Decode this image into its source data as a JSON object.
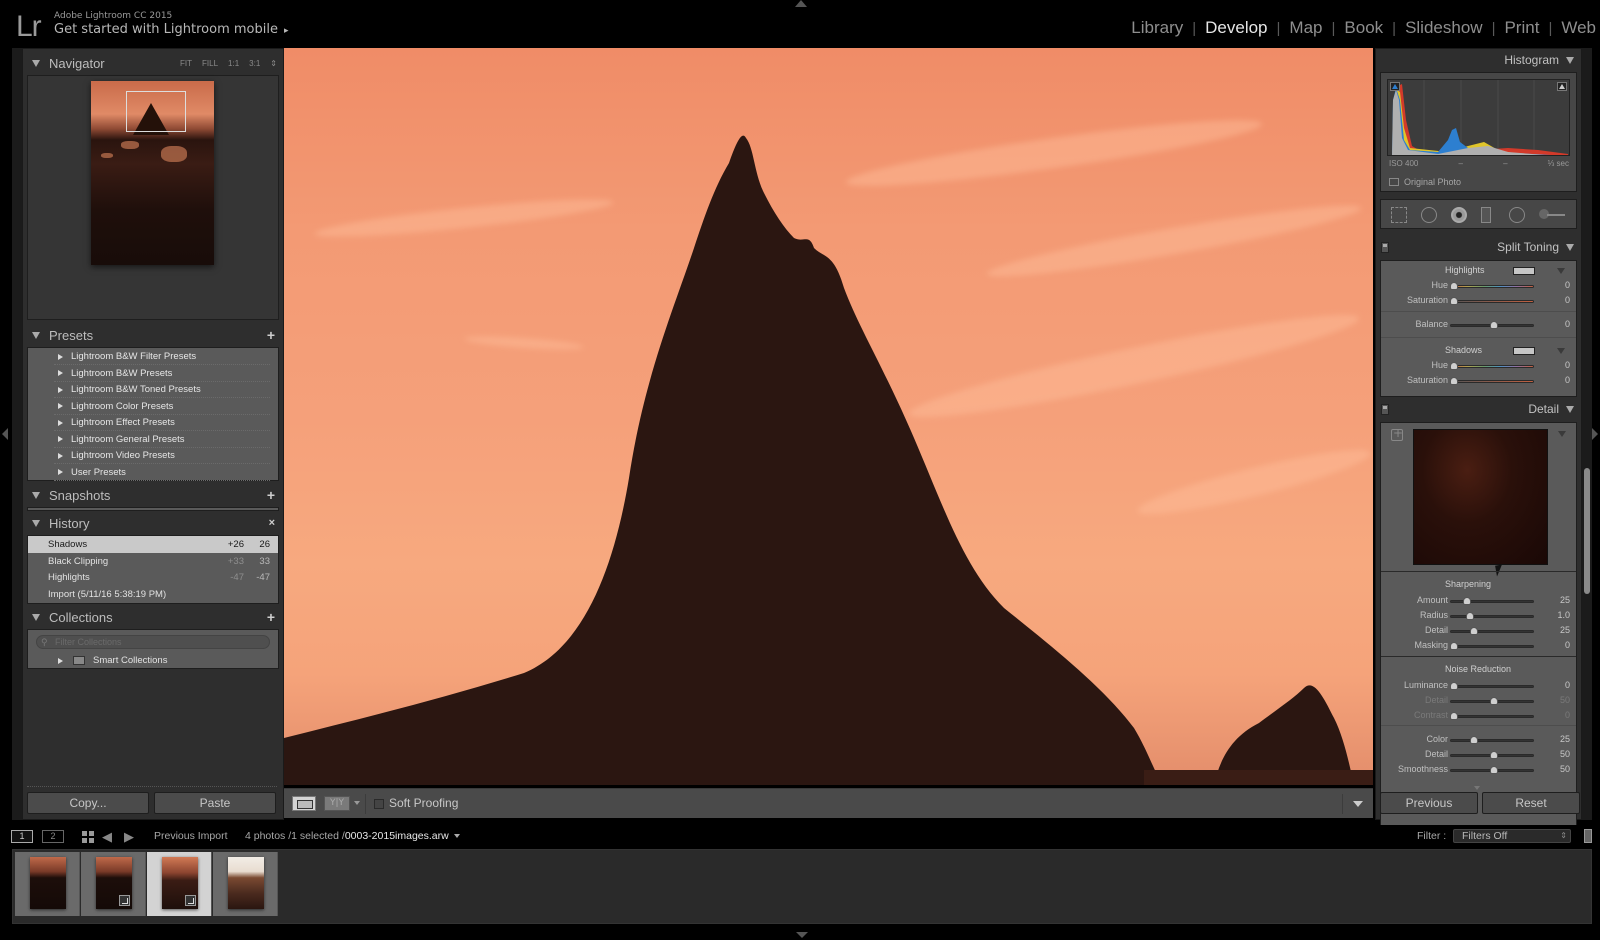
{
  "app": {
    "logo": "Lr",
    "title": "Adobe Lightroom CC 2015",
    "mobile_link": "Get started with Lightroom mobile",
    "mobile_arrow": "▸"
  },
  "modules": [
    {
      "label": "Library",
      "active": false
    },
    {
      "label": "Develop",
      "active": true
    },
    {
      "label": "Map",
      "active": false
    },
    {
      "label": "Book",
      "active": false
    },
    {
      "label": "Slideshow",
      "active": false
    },
    {
      "label": "Print",
      "active": false
    },
    {
      "label": "Web",
      "active": false
    }
  ],
  "module_separator": "|",
  "left_panel": {
    "navigator": {
      "title": "Navigator",
      "zoom_options": [
        "FIT",
        "FILL",
        "1:1",
        "3:1"
      ],
      "zoom_arrow": "⇕"
    },
    "presets": {
      "title": "Presets",
      "add": "+",
      "items": [
        "Lightroom B&W Filter Presets",
        "Lightroom B&W Presets",
        "Lightroom B&W Toned Presets",
        "Lightroom Color Presets",
        "Lightroom Effect Presets",
        "Lightroom General Presets",
        "Lightroom Video Presets",
        "User Presets"
      ]
    },
    "snapshots": {
      "title": "Snapshots",
      "add": "+"
    },
    "history": {
      "title": "History",
      "clear": "×",
      "items": [
        {
          "name": "Shadows",
          "delta": "+26",
          "value": "26",
          "selected": true
        },
        {
          "name": "Black Clipping",
          "delta": "+33",
          "value": "33",
          "selected": false
        },
        {
          "name": "Highlights",
          "delta": "-47",
          "value": "-47",
          "selected": false
        },
        {
          "name": "Import (5/11/16 5:38:19 PM)",
          "delta": "",
          "value": "",
          "selected": false
        }
      ]
    },
    "collections": {
      "title": "Collections",
      "add": "+",
      "filter_placeholder": "Filter Collections",
      "filter_icon": "⚲",
      "items": [
        "Smart Collections"
      ]
    },
    "copy_label": "Copy...",
    "paste_label": "Paste"
  },
  "toolbar": {
    "before_after_label": "Y|Y",
    "soft_proofing_label": "Soft Proofing",
    "soft_proofing_checked": false
  },
  "right_panel": {
    "histogram": {
      "title": "Histogram",
      "iso": "ISO 400",
      "focal": "–",
      "aperture": "–",
      "shutter": "⅓ sec",
      "original_photo": "Original Photo"
    },
    "split_toning": {
      "title": "Split Toning",
      "highlights_label": "Highlights",
      "shadows_label": "Shadows",
      "highlights": [
        {
          "label": "Hue",
          "value": "0",
          "fraction": 0.0,
          "kind": "hue"
        },
        {
          "label": "Saturation",
          "value": "0",
          "fraction": 0.0,
          "kind": "sat"
        }
      ],
      "balance": {
        "label": "Balance",
        "value": "0",
        "fraction": 0.5
      },
      "shadows": [
        {
          "label": "Hue",
          "value": "0",
          "fraction": 0.0,
          "kind": "hue"
        },
        {
          "label": "Saturation",
          "value": "0",
          "fraction": 0.0,
          "kind": "sat"
        }
      ]
    },
    "detail": {
      "title": "Detail",
      "sharpening_label": "Sharpening",
      "sharpening": [
        {
          "label": "Amount",
          "value": "25",
          "fraction": 0.167,
          "dim": false
        },
        {
          "label": "Radius",
          "value": "1.0",
          "fraction": 0.2,
          "dim": false
        },
        {
          "label": "Detail",
          "value": "25",
          "fraction": 0.25,
          "dim": false
        },
        {
          "label": "Masking",
          "value": "0",
          "fraction": 0.0,
          "dim": false
        }
      ],
      "noise_label": "Noise Reduction",
      "noise_luminance": [
        {
          "label": "Luminance",
          "value": "0",
          "fraction": 0.0,
          "dim": false
        },
        {
          "label": "Detail",
          "value": "50",
          "fraction": 0.5,
          "dim": true
        },
        {
          "label": "Contrast",
          "value": "0",
          "fraction": 0.0,
          "dim": true
        }
      ],
      "noise_color": [
        {
          "label": "Color",
          "value": "25",
          "fraction": 0.25,
          "dim": false
        },
        {
          "label": "Detail",
          "value": "50",
          "fraction": 0.5,
          "dim": false
        },
        {
          "label": "Smoothness",
          "value": "50",
          "fraction": 0.5,
          "dim": false
        }
      ]
    },
    "previous_label": "Previous",
    "reset_label": "Reset"
  },
  "filmstrip": {
    "screen1": "1",
    "screen2": "2",
    "back": "◀",
    "forward": "▶",
    "source": "Previous Import",
    "count": "4 photos /1 selected /",
    "filename": "0003-2015images.arw",
    "filter_label": "Filter :",
    "filter_value": "Filters Off",
    "filter_arrows": "⇕",
    "thumbnails": [
      {
        "selected": false,
        "badge": false,
        "tone": "dark"
      },
      {
        "selected": false,
        "badge": true,
        "tone": "dark"
      },
      {
        "selected": true,
        "badge": true,
        "tone": "mid"
      },
      {
        "selected": false,
        "badge": false,
        "tone": "bright"
      }
    ]
  },
  "colors": {
    "sky_light": "#f7a97f",
    "sky_dark": "#f08c67",
    "rock": "#2b1611",
    "panel_bg": "#2e2e2e",
    "panel_body": "#5a5a5a",
    "selected_history": "#c9c9c9"
  }
}
